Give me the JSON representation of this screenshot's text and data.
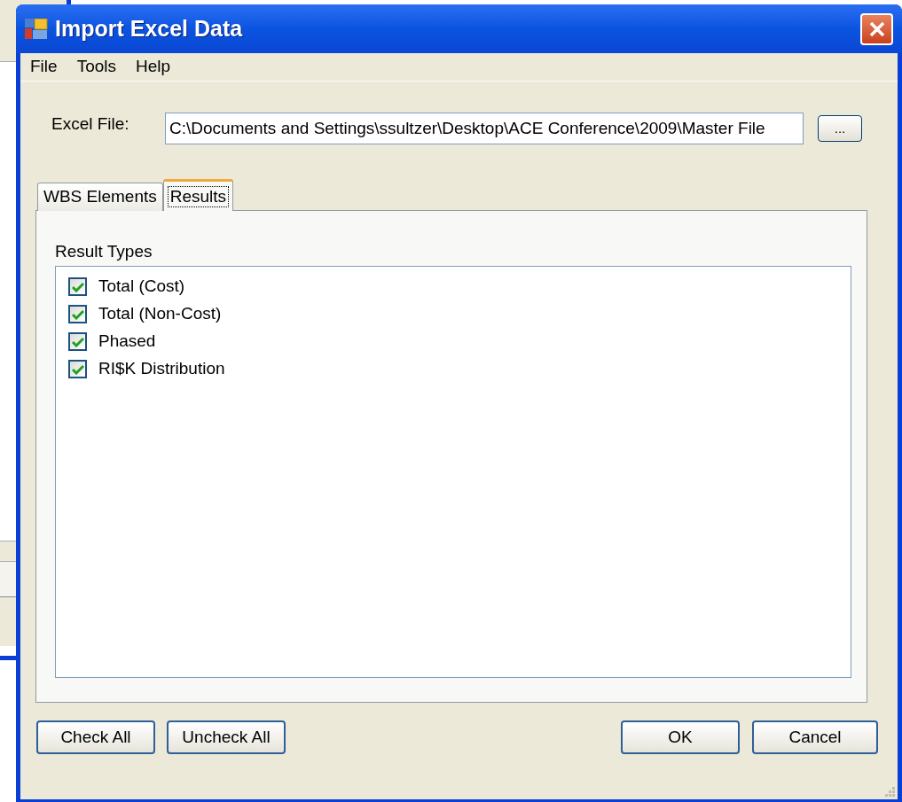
{
  "window": {
    "title": "Import Excel Data"
  },
  "menu": [
    {
      "label": "File"
    },
    {
      "label": "Tools"
    },
    {
      "label": "Help"
    }
  ],
  "excel_file": {
    "label": "Excel File:",
    "value": "C:\\Documents and Settings\\ssultzer\\Desktop\\ACE Conference\\2009\\Master File",
    "browse_button": "..."
  },
  "tabs": [
    {
      "label": "WBS Elements",
      "selected": false
    },
    {
      "label": "Results",
      "selected": true
    }
  ],
  "result_types": {
    "label": "Result Types",
    "items": [
      {
        "label": "Total (Cost)",
        "checked": true
      },
      {
        "label": "Total (Non-Cost)",
        "checked": true
      },
      {
        "label": "Phased",
        "checked": true
      },
      {
        "label": "RI$K Distribution",
        "checked": true
      }
    ]
  },
  "left_buttons": [
    {
      "label": "Check All"
    },
    {
      "label": "Uncheck All"
    }
  ],
  "right_buttons": [
    {
      "label": "OK"
    },
    {
      "label": "Cancel"
    }
  ]
}
